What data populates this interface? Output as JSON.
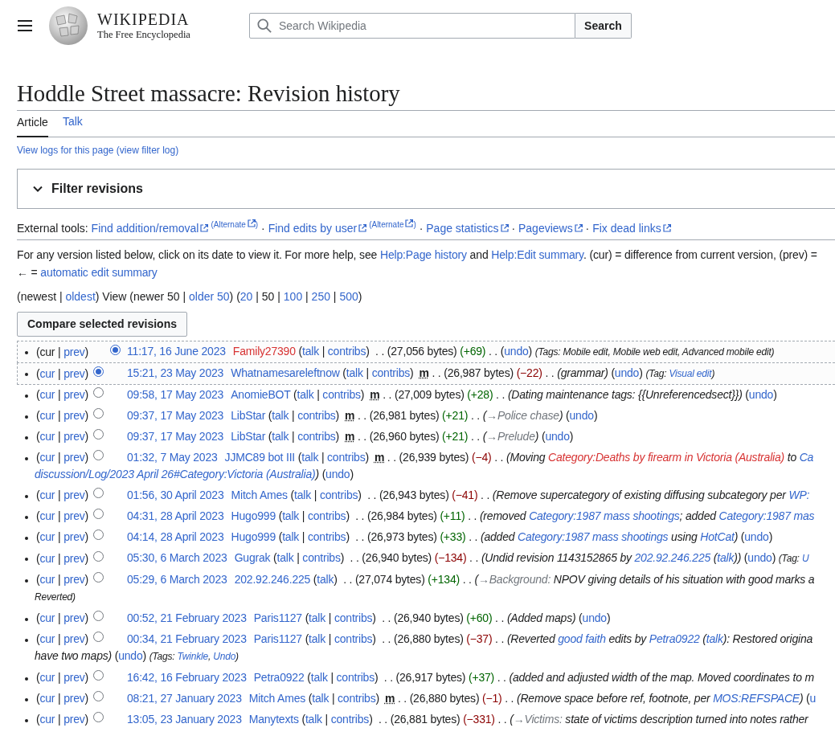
{
  "header": {
    "wordmark": "WIKIPEDIA",
    "tagline": "The Free Encyclopedia",
    "search": {
      "placeholder": "Search Wikipedia"
    },
    "search_button": "Search"
  },
  "title": "Hoddle Street massacre: Revision history",
  "tabs": [
    {
      "label": "Article",
      "selected": true
    },
    {
      "label": "Talk",
      "selected": false
    }
  ],
  "logs": [
    {
      "kind": "link",
      "text": "View logs for this page"
    },
    {
      "kind": "link",
      "text": " (view filter log)"
    }
  ],
  "filter": {
    "label": "Filter revisions",
    "expanded": false
  },
  "external_tools": [
    {
      "kind": "plain",
      "text": "External tools: "
    },
    {
      "kind": "external",
      "text": "Find addition/removal"
    },
    {
      "kind": "alternate",
      "text": "(Alternate",
      "close": ")"
    },
    {
      "kind": "plain",
      "text": " · "
    },
    {
      "kind": "external",
      "text": "Find edits by user"
    },
    {
      "kind": "alternate",
      "text": "(Alternate",
      "close": ")"
    },
    {
      "kind": "plain",
      "text": " · "
    },
    {
      "kind": "external",
      "text": "Page statistics"
    },
    {
      "kind": "plain",
      "text": " · "
    },
    {
      "kind": "external",
      "text": "Pageviews"
    },
    {
      "kind": "plain",
      "text": " · "
    },
    {
      "kind": "external",
      "text": "Fix dead links"
    }
  ],
  "help": [
    [
      {
        "kind": "plain",
        "text": "For any version listed below, click on its date to view it. For more help, see "
      },
      {
        "kind": "link",
        "text": "Help:Page history"
      },
      {
        "kind": "plain",
        "text": " and "
      },
      {
        "kind": "link",
        "text": "Help:Edit summary"
      },
      {
        "kind": "plain",
        "text": ". (cur) = difference from current version, (prev) ="
      }
    ],
    [
      {
        "kind": "plain",
        "text": "← = "
      },
      {
        "kind": "link",
        "text": "automatic edit summary"
      }
    ]
  ],
  "nav": [
    {
      "kind": "plain",
      "text": "(newest | "
    },
    {
      "kind": "link",
      "text": "oldest"
    },
    {
      "kind": "plain",
      "text": ") View (newer 50 | "
    },
    {
      "kind": "link",
      "text": "older 50"
    },
    {
      "kind": "plain",
      "text": ") ("
    },
    {
      "kind": "link",
      "text": "20"
    },
    {
      "kind": "plain",
      "text": " | 50 | "
    },
    {
      "kind": "link",
      "text": "100"
    },
    {
      "kind": "plain",
      "text": " | "
    },
    {
      "kind": "link",
      "text": "250"
    },
    {
      "kind": "plain",
      "text": " | "
    },
    {
      "kind": "link",
      "text": "500"
    },
    {
      "kind": "plain",
      "text": ")"
    }
  ],
  "compare_button": "Compare selected revisions",
  "revisions": [
    {
      "in_range": true,
      "radio_right": {
        "selected": true
      },
      "lead": [
        {
          "kind": "plain",
          "text": "(cur | "
        },
        {
          "kind": "link",
          "text": "prev"
        },
        {
          "kind": "plain",
          "text": ")"
        }
      ],
      "segs": [
        {
          "kind": "date",
          "text": "11:17, 16 June 2023"
        },
        {
          "kind": "red_user",
          "text": "Family27390"
        },
        {
          "kind": "plain",
          "text": " ("
        },
        {
          "kind": "link",
          "text": "talk"
        },
        {
          "kind": "plain",
          "text": " | "
        },
        {
          "kind": "link",
          "text": "contribs"
        },
        {
          "kind": "plain",
          "text": ")  . . (27,056 bytes) "
        },
        {
          "kind": "gain",
          "text": "(+69)"
        },
        {
          "kind": "plain",
          "text": " . . ("
        },
        {
          "kind": "link",
          "text": "undo"
        },
        {
          "kind": "plain",
          "text": ") "
        },
        {
          "kind": "tag",
          "text": "(Tags: Mobile edit, Mobile web edit, Advanced mobile edit)"
        }
      ]
    },
    {
      "in_range": true,
      "radio_left": {
        "selected": true
      },
      "lead": [
        {
          "kind": "plain",
          "text": "("
        },
        {
          "kind": "link",
          "text": "cur"
        },
        {
          "kind": "plain",
          "text": " | "
        },
        {
          "kind": "link",
          "text": "prev"
        },
        {
          "kind": "plain",
          "text": ")"
        }
      ],
      "segs": [
        {
          "kind": "date",
          "text": "15:21, 23 May 2023"
        },
        {
          "kind": "user",
          "text": "Whatnamesareleftnow"
        },
        {
          "kind": "plain",
          "text": " ("
        },
        {
          "kind": "link",
          "text": "talk"
        },
        {
          "kind": "plain",
          "text": " | "
        },
        {
          "kind": "link",
          "text": "contribs"
        },
        {
          "kind": "plain",
          "text": ")"
        },
        {
          "kind": "minor",
          "text": "m"
        },
        {
          "kind": "plain",
          "text": " . . (26,987 bytes) "
        },
        {
          "kind": "loss",
          "text": "(−22)"
        },
        {
          "kind": "plain",
          "text": " . . "
        },
        {
          "kind": "comment",
          "text": "(grammar)"
        },
        {
          "kind": "plain",
          "text": " ("
        },
        {
          "kind": "link",
          "text": "undo"
        },
        {
          "kind": "plain",
          "text": ") "
        },
        {
          "kind": "tag",
          "text": "(Tag: "
        },
        {
          "kind": "tag_link",
          "text": "Visual edit"
        },
        {
          "kind": "tag",
          "text": ")"
        }
      ]
    },
    {
      "in_range": false,
      "radio_left": {
        "selected": false
      },
      "lead": [
        {
          "kind": "plain",
          "text": "("
        },
        {
          "kind": "link",
          "text": "cur"
        },
        {
          "kind": "plain",
          "text": " | "
        },
        {
          "kind": "link",
          "text": "prev"
        },
        {
          "kind": "plain",
          "text": ")"
        }
      ],
      "segs": [
        {
          "kind": "date",
          "text": "09:58, 17 May 2023"
        },
        {
          "kind": "user",
          "text": "AnomieBOT"
        },
        {
          "kind": "plain",
          "text": " ("
        },
        {
          "kind": "link",
          "text": "talk"
        },
        {
          "kind": "plain",
          "text": " | "
        },
        {
          "kind": "link",
          "text": "contribs"
        },
        {
          "kind": "plain",
          "text": ")"
        },
        {
          "kind": "minor",
          "text": "m"
        },
        {
          "kind": "plain",
          "text": " . . (27,009 bytes) "
        },
        {
          "kind": "gain",
          "text": "(+28)"
        },
        {
          "kind": "plain",
          "text": " . . "
        },
        {
          "kind": "comment",
          "text": "(Dating maintenance tags: {{Unreferencedsect}})"
        },
        {
          "kind": "plain",
          "text": " ("
        },
        {
          "kind": "link",
          "text": "undo"
        },
        {
          "kind": "plain",
          "text": ")"
        }
      ]
    },
    {
      "in_range": false,
      "radio_left": {
        "selected": false
      },
      "lead": [
        {
          "kind": "plain",
          "text": "("
        },
        {
          "kind": "link",
          "text": "cur"
        },
        {
          "kind": "plain",
          "text": " | "
        },
        {
          "kind": "link",
          "text": "prev"
        },
        {
          "kind": "plain",
          "text": ")"
        }
      ],
      "segs": [
        {
          "kind": "date",
          "text": "09:37, 17 May 2023"
        },
        {
          "kind": "user",
          "text": "LibStar"
        },
        {
          "kind": "plain",
          "text": " ("
        },
        {
          "kind": "link",
          "text": "talk"
        },
        {
          "kind": "plain",
          "text": " | "
        },
        {
          "kind": "link",
          "text": "contribs"
        },
        {
          "kind": "plain",
          "text": ")"
        },
        {
          "kind": "minor",
          "text": "m"
        },
        {
          "kind": "plain",
          "text": " . . (26,981 bytes) "
        },
        {
          "kind": "gain",
          "text": "(+21)"
        },
        {
          "kind": "plain",
          "text": " . . "
        },
        {
          "kind": "comment",
          "text": "("
        },
        {
          "kind": "section",
          "text": "→Police chase"
        },
        {
          "kind": "comment",
          "text": ")"
        },
        {
          "kind": "plain",
          "text": " ("
        },
        {
          "kind": "link",
          "text": "undo"
        },
        {
          "kind": "plain",
          "text": ")"
        }
      ]
    },
    {
      "in_range": false,
      "radio_left": {
        "selected": false
      },
      "lead": [
        {
          "kind": "plain",
          "text": "("
        },
        {
          "kind": "link",
          "text": "cur"
        },
        {
          "kind": "plain",
          "text": " | "
        },
        {
          "kind": "link",
          "text": "prev"
        },
        {
          "kind": "plain",
          "text": ")"
        }
      ],
      "segs": [
        {
          "kind": "date",
          "text": "09:37, 17 May 2023"
        },
        {
          "kind": "user",
          "text": "LibStar"
        },
        {
          "kind": "plain",
          "text": " ("
        },
        {
          "kind": "link",
          "text": "talk"
        },
        {
          "kind": "plain",
          "text": " | "
        },
        {
          "kind": "link",
          "text": "contribs"
        },
        {
          "kind": "plain",
          "text": ")"
        },
        {
          "kind": "minor",
          "text": "m"
        },
        {
          "kind": "plain",
          "text": " . . (26,960 bytes) "
        },
        {
          "kind": "gain",
          "text": "(+21)"
        },
        {
          "kind": "plain",
          "text": " . . "
        },
        {
          "kind": "comment",
          "text": "("
        },
        {
          "kind": "section",
          "text": "→Prelude"
        },
        {
          "kind": "comment",
          "text": ")"
        },
        {
          "kind": "plain",
          "text": " ("
        },
        {
          "kind": "link",
          "text": "undo"
        },
        {
          "kind": "plain",
          "text": ")"
        }
      ]
    },
    {
      "in_range": false,
      "radio_left": {
        "selected": false
      },
      "lead": [
        {
          "kind": "plain",
          "text": "("
        },
        {
          "kind": "link",
          "text": "cur"
        },
        {
          "kind": "plain",
          "text": " | "
        },
        {
          "kind": "link",
          "text": "prev"
        },
        {
          "kind": "plain",
          "text": ")"
        }
      ],
      "segs": [
        {
          "kind": "date",
          "text": "01:32, 7 May 2023"
        },
        {
          "kind": "user",
          "text": "JJMC89 bot III"
        },
        {
          "kind": "plain",
          "text": " ("
        },
        {
          "kind": "link",
          "text": "talk"
        },
        {
          "kind": "plain",
          "text": " | "
        },
        {
          "kind": "link",
          "text": "contribs"
        },
        {
          "kind": "plain",
          "text": ")"
        },
        {
          "kind": "minor",
          "text": "m"
        },
        {
          "kind": "plain",
          "text": " . . (26,939 bytes) "
        },
        {
          "kind": "loss",
          "text": "(−4)"
        },
        {
          "kind": "plain",
          "text": " . . "
        },
        {
          "kind": "comment",
          "text": "(Moving "
        },
        {
          "kind": "comment_redlink",
          "text": "Category:Deaths by firearm in Victoria (Australia)"
        },
        {
          "kind": "comment",
          "text": " to "
        },
        {
          "kind": "comment_link",
          "text": "Ca"
        }
      ],
      "cont": [
        {
          "kind": "comment_link",
          "text": "discussion/Log/2023 April 26#Category:Victoria (Australia)"
        },
        {
          "kind": "comment",
          "text": ")"
        },
        {
          "kind": "plain",
          "text": " ("
        },
        {
          "kind": "link",
          "text": "undo"
        },
        {
          "kind": "plain",
          "text": ")"
        }
      ]
    },
    {
      "in_range": false,
      "radio_left": {
        "selected": false
      },
      "lead": [
        {
          "kind": "plain",
          "text": "("
        },
        {
          "kind": "link",
          "text": "cur"
        },
        {
          "kind": "plain",
          "text": " | "
        },
        {
          "kind": "link",
          "text": "prev"
        },
        {
          "kind": "plain",
          "text": ")"
        }
      ],
      "segs": [
        {
          "kind": "date",
          "text": "01:56, 30 April 2023"
        },
        {
          "kind": "user",
          "text": "Mitch Ames"
        },
        {
          "kind": "plain",
          "text": " ("
        },
        {
          "kind": "link",
          "text": "talk"
        },
        {
          "kind": "plain",
          "text": " | "
        },
        {
          "kind": "link",
          "text": "contribs"
        },
        {
          "kind": "plain",
          "text": ")  . . (26,943 bytes) "
        },
        {
          "kind": "loss",
          "text": "(−41)"
        },
        {
          "kind": "plain",
          "text": " . . "
        },
        {
          "kind": "comment",
          "text": "(Remove supercategory of existing diffusing subcategory per "
        },
        {
          "kind": "comment_link",
          "text": "WP:"
        }
      ]
    },
    {
      "in_range": false,
      "radio_left": {
        "selected": false
      },
      "lead": [
        {
          "kind": "plain",
          "text": "("
        },
        {
          "kind": "link",
          "text": "cur"
        },
        {
          "kind": "plain",
          "text": " | "
        },
        {
          "kind": "link",
          "text": "prev"
        },
        {
          "kind": "plain",
          "text": ")"
        }
      ],
      "segs": [
        {
          "kind": "date",
          "text": "04:31, 28 April 2023"
        },
        {
          "kind": "user",
          "text": "Hugo999"
        },
        {
          "kind": "plain",
          "text": " ("
        },
        {
          "kind": "link",
          "text": "talk"
        },
        {
          "kind": "plain",
          "text": " | "
        },
        {
          "kind": "link",
          "text": "contribs"
        },
        {
          "kind": "plain",
          "text": ")  . . (26,984 bytes) "
        },
        {
          "kind": "gain",
          "text": "(+11)"
        },
        {
          "kind": "plain",
          "text": " . . "
        },
        {
          "kind": "comment",
          "text": "(removed "
        },
        {
          "kind": "comment_link",
          "text": "Category:1987 mass shootings"
        },
        {
          "kind": "comment",
          "text": "; added "
        },
        {
          "kind": "comment_link",
          "text": "Category:1987 mas"
        }
      ]
    },
    {
      "in_range": false,
      "radio_left": {
        "selected": false
      },
      "lead": [
        {
          "kind": "plain",
          "text": "("
        },
        {
          "kind": "link",
          "text": "cur"
        },
        {
          "kind": "plain",
          "text": " | "
        },
        {
          "kind": "link",
          "text": "prev"
        },
        {
          "kind": "plain",
          "text": ")"
        }
      ],
      "segs": [
        {
          "kind": "date",
          "text": "04:14, 28 April 2023"
        },
        {
          "kind": "user",
          "text": "Hugo999"
        },
        {
          "kind": "plain",
          "text": " ("
        },
        {
          "kind": "link",
          "text": "talk"
        },
        {
          "kind": "plain",
          "text": " | "
        },
        {
          "kind": "link",
          "text": "contribs"
        },
        {
          "kind": "plain",
          "text": ")  . . (26,973 bytes) "
        },
        {
          "kind": "gain",
          "text": "(+33)"
        },
        {
          "kind": "plain",
          "text": " . . "
        },
        {
          "kind": "comment",
          "text": "(added "
        },
        {
          "kind": "comment_link",
          "text": "Category:1987 mass shootings"
        },
        {
          "kind": "comment",
          "text": " using "
        },
        {
          "kind": "comment_link",
          "text": "HotCat"
        },
        {
          "kind": "comment",
          "text": ")"
        },
        {
          "kind": "plain",
          "text": " ("
        },
        {
          "kind": "link",
          "text": "undo"
        },
        {
          "kind": "plain",
          "text": ")"
        }
      ]
    },
    {
      "in_range": false,
      "radio_left": {
        "selected": false
      },
      "lead": [
        {
          "kind": "plain",
          "text": "("
        },
        {
          "kind": "link",
          "text": "cur"
        },
        {
          "kind": "plain",
          "text": " | "
        },
        {
          "kind": "link",
          "text": "prev"
        },
        {
          "kind": "plain",
          "text": ")"
        }
      ],
      "segs": [
        {
          "kind": "date",
          "text": "05:30, 6 March 2023"
        },
        {
          "kind": "user",
          "text": "Gugrak"
        },
        {
          "kind": "plain",
          "text": " ("
        },
        {
          "kind": "link",
          "text": "talk"
        },
        {
          "kind": "plain",
          "text": " | "
        },
        {
          "kind": "link",
          "text": "contribs"
        },
        {
          "kind": "plain",
          "text": ")  . . (26,940 bytes) "
        },
        {
          "kind": "loss",
          "text": "(−134)"
        },
        {
          "kind": "plain",
          "text": " . . "
        },
        {
          "kind": "comment",
          "text": "(Undid revision 1143152865 by "
        },
        {
          "kind": "comment_link",
          "text": "202.92.246.225"
        },
        {
          "kind": "comment",
          "text": " ("
        },
        {
          "kind": "comment_link",
          "text": "talk"
        },
        {
          "kind": "comment",
          "text": "))"
        },
        {
          "kind": "plain",
          "text": " ("
        },
        {
          "kind": "link",
          "text": "undo"
        },
        {
          "kind": "plain",
          "text": ") "
        },
        {
          "kind": "tag",
          "text": "(Tag: "
        },
        {
          "kind": "tag_link",
          "text": "U"
        }
      ]
    },
    {
      "in_range": false,
      "radio_left": {
        "selected": false
      },
      "lead": [
        {
          "kind": "plain",
          "text": "("
        },
        {
          "kind": "link",
          "text": "cur"
        },
        {
          "kind": "plain",
          "text": " | "
        },
        {
          "kind": "link",
          "text": "prev"
        },
        {
          "kind": "plain",
          "text": ")"
        }
      ],
      "segs": [
        {
          "kind": "date",
          "text": "05:29, 6 March 2023"
        },
        {
          "kind": "user",
          "text": "202.92.246.225"
        },
        {
          "kind": "plain",
          "text": " ("
        },
        {
          "kind": "link",
          "text": "talk"
        },
        {
          "kind": "plain",
          "text": ")  . . (27,074 bytes) "
        },
        {
          "kind": "gain",
          "text": "(+134)"
        },
        {
          "kind": "plain",
          "text": " . . "
        },
        {
          "kind": "comment",
          "text": "("
        },
        {
          "kind": "section",
          "text": "→Background:"
        },
        {
          "kind": "comment",
          "text": " NPOV giving details of his situation with good marks a"
        }
      ],
      "cont": [
        {
          "kind": "tag",
          "text": "Reverted)"
        }
      ]
    },
    {
      "in_range": false,
      "radio_left": {
        "selected": false
      },
      "lead": [
        {
          "kind": "plain",
          "text": "("
        },
        {
          "kind": "link",
          "text": "cur"
        },
        {
          "kind": "plain",
          "text": " | "
        },
        {
          "kind": "link",
          "text": "prev"
        },
        {
          "kind": "plain",
          "text": ")"
        }
      ],
      "segs": [
        {
          "kind": "date",
          "text": "00:52, 21 February 2023"
        },
        {
          "kind": "user",
          "text": "Paris1127"
        },
        {
          "kind": "plain",
          "text": " ("
        },
        {
          "kind": "link",
          "text": "talk"
        },
        {
          "kind": "plain",
          "text": " | "
        },
        {
          "kind": "link",
          "text": "contribs"
        },
        {
          "kind": "plain",
          "text": ")  . . (26,940 bytes) "
        },
        {
          "kind": "gain",
          "text": "(+60)"
        },
        {
          "kind": "plain",
          "text": " . . "
        },
        {
          "kind": "comment",
          "text": "(Added maps)"
        },
        {
          "kind": "plain",
          "text": " ("
        },
        {
          "kind": "link",
          "text": "undo"
        },
        {
          "kind": "plain",
          "text": ")"
        }
      ]
    },
    {
      "in_range": false,
      "radio_left": {
        "selected": false
      },
      "lead": [
        {
          "kind": "plain",
          "text": "("
        },
        {
          "kind": "link",
          "text": "cur"
        },
        {
          "kind": "plain",
          "text": " | "
        },
        {
          "kind": "link",
          "text": "prev"
        },
        {
          "kind": "plain",
          "text": ")"
        }
      ],
      "segs": [
        {
          "kind": "date",
          "text": "00:34, 21 February 2023"
        },
        {
          "kind": "user",
          "text": "Paris1127"
        },
        {
          "kind": "plain",
          "text": " ("
        },
        {
          "kind": "link",
          "text": "talk"
        },
        {
          "kind": "plain",
          "text": " | "
        },
        {
          "kind": "link",
          "text": "contribs"
        },
        {
          "kind": "plain",
          "text": ")  . . (26,880 bytes) "
        },
        {
          "kind": "loss",
          "text": "(−37)"
        },
        {
          "kind": "plain",
          "text": " . . "
        },
        {
          "kind": "comment",
          "text": "(Reverted "
        },
        {
          "kind": "comment_link",
          "text": "good faith"
        },
        {
          "kind": "comment",
          "text": " edits by "
        },
        {
          "kind": "comment_link",
          "text": "Petra0922"
        },
        {
          "kind": "comment",
          "text": " ("
        },
        {
          "kind": "comment_link",
          "text": "talk"
        },
        {
          "kind": "comment",
          "text": "): Restored origina"
        }
      ],
      "cont": [
        {
          "kind": "comment",
          "text": "have two maps)"
        },
        {
          "kind": "plain",
          "text": " ("
        },
        {
          "kind": "link",
          "text": "undo"
        },
        {
          "kind": "plain",
          "text": ") "
        },
        {
          "kind": "tag",
          "text": "(Tags: "
        },
        {
          "kind": "tag_link",
          "text": "Twinkle"
        },
        {
          "kind": "tag",
          "text": ", "
        },
        {
          "kind": "tag_link",
          "text": "Undo"
        },
        {
          "kind": "tag",
          "text": ")"
        }
      ]
    },
    {
      "in_range": false,
      "radio_left": {
        "selected": false
      },
      "lead": [
        {
          "kind": "plain",
          "text": "("
        },
        {
          "kind": "link",
          "text": "cur"
        },
        {
          "kind": "plain",
          "text": " | "
        },
        {
          "kind": "link",
          "text": "prev"
        },
        {
          "kind": "plain",
          "text": ")"
        }
      ],
      "segs": [
        {
          "kind": "date",
          "text": "16:42, 16 February 2023"
        },
        {
          "kind": "user",
          "text": "Petra0922"
        },
        {
          "kind": "plain",
          "text": " ("
        },
        {
          "kind": "link",
          "text": "talk"
        },
        {
          "kind": "plain",
          "text": " | "
        },
        {
          "kind": "link",
          "text": "contribs"
        },
        {
          "kind": "plain",
          "text": ")  . . (26,917 bytes) "
        },
        {
          "kind": "gain",
          "text": "(+37)"
        },
        {
          "kind": "plain",
          "text": " . . "
        },
        {
          "kind": "comment",
          "text": "(added and adjusted width of the map. Moved coordinates to m"
        }
      ]
    },
    {
      "in_range": false,
      "radio_left": {
        "selected": false
      },
      "lead": [
        {
          "kind": "plain",
          "text": "("
        },
        {
          "kind": "link",
          "text": "cur"
        },
        {
          "kind": "plain",
          "text": " | "
        },
        {
          "kind": "link",
          "text": "prev"
        },
        {
          "kind": "plain",
          "text": ")"
        }
      ],
      "segs": [
        {
          "kind": "date",
          "text": "08:21, 27 January 2023"
        },
        {
          "kind": "user",
          "text": "Mitch Ames"
        },
        {
          "kind": "plain",
          "text": " ("
        },
        {
          "kind": "link",
          "text": "talk"
        },
        {
          "kind": "plain",
          "text": " | "
        },
        {
          "kind": "link",
          "text": "contribs"
        },
        {
          "kind": "plain",
          "text": ")"
        },
        {
          "kind": "minor",
          "text": "m"
        },
        {
          "kind": "plain",
          "text": " . . (26,880 bytes) "
        },
        {
          "kind": "loss",
          "text": "(−1)"
        },
        {
          "kind": "plain",
          "text": " . . "
        },
        {
          "kind": "comment",
          "text": "(Remove space before ref, footnote, per "
        },
        {
          "kind": "comment_link",
          "text": "MOS:REFSPACE"
        },
        {
          "kind": "comment",
          "text": ")"
        },
        {
          "kind": "plain",
          "text": " ("
        },
        {
          "kind": "link",
          "text": "u"
        }
      ]
    },
    {
      "in_range": false,
      "radio_left": {
        "selected": false
      },
      "lead": [
        {
          "kind": "plain",
          "text": "("
        },
        {
          "kind": "link",
          "text": "cur"
        },
        {
          "kind": "plain",
          "text": " | "
        },
        {
          "kind": "link",
          "text": "prev"
        },
        {
          "kind": "plain",
          "text": ")"
        }
      ],
      "segs": [
        {
          "kind": "date",
          "text": "13:05, 23 January 2023"
        },
        {
          "kind": "user",
          "text": "Manytexts"
        },
        {
          "kind": "plain",
          "text": " ("
        },
        {
          "kind": "link",
          "text": "talk"
        },
        {
          "kind": "plain",
          "text": " | "
        },
        {
          "kind": "link",
          "text": "contribs"
        },
        {
          "kind": "plain",
          "text": ")  . . (26,881 bytes) "
        },
        {
          "kind": "loss",
          "text": "(−331)"
        },
        {
          "kind": "plain",
          "text": " . . "
        },
        {
          "kind": "comment",
          "text": "("
        },
        {
          "kind": "section",
          "text": "→Victims:"
        },
        {
          "kind": "comment",
          "text": " state of victims description turned into notes rather"
        }
      ]
    }
  ]
}
